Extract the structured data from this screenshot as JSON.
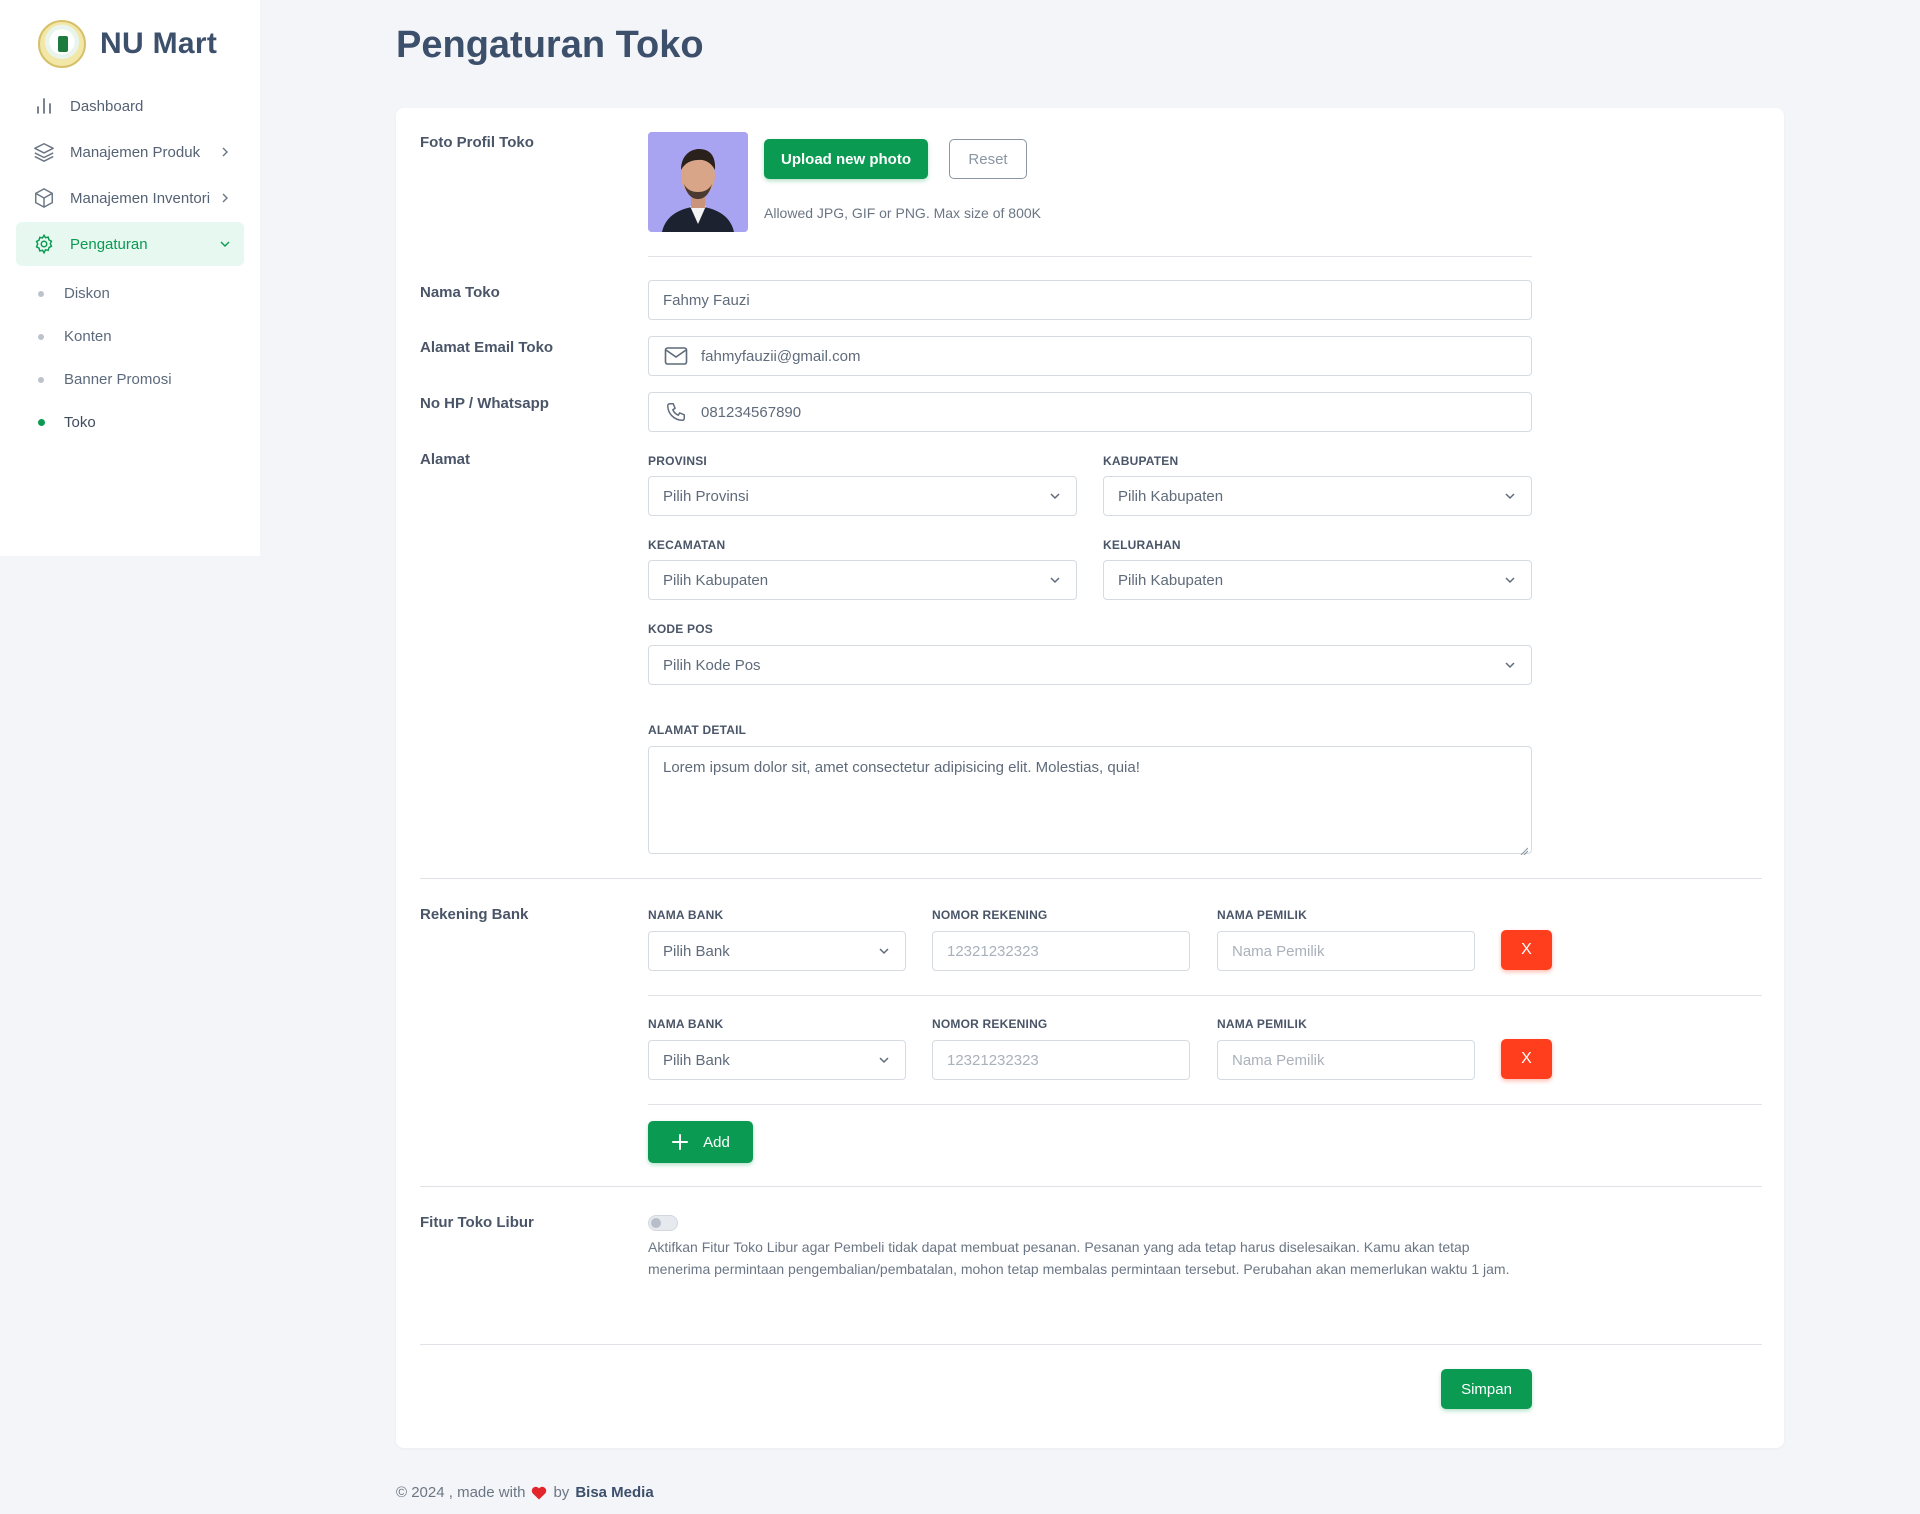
{
  "brand": {
    "name": "NU Mart"
  },
  "sidebar": {
    "items": [
      {
        "label": "Dashboard",
        "icon": "bar-chart-icon"
      },
      {
        "label": "Manajemen Produk",
        "icon": "layers-icon"
      },
      {
        "label": "Manajemen Inventori",
        "icon": "box-icon"
      },
      {
        "label": "Pengaturan",
        "icon": "gear-icon",
        "active": true
      }
    ],
    "subitems": [
      {
        "label": "Diskon"
      },
      {
        "label": "Konten"
      },
      {
        "label": "Banner Promosi"
      },
      {
        "label": "Toko",
        "active": true
      }
    ]
  },
  "page": {
    "title": "Pengaturan Toko"
  },
  "form": {
    "photo": {
      "label": "Foto Profil Toko",
      "upload_label": "Upload new photo",
      "reset_label": "Reset",
      "help": "Allowed JPG, GIF or PNG. Max size of 800K"
    },
    "nama_toko": {
      "label": "Nama Toko",
      "value": "Fahmy Fauzi"
    },
    "email": {
      "label": "Alamat Email Toko",
      "value": "fahmyfauzii@gmail.com"
    },
    "phone": {
      "label": "No HP / Whatsapp",
      "value": "081234567890"
    },
    "alamat": {
      "label": "Alamat",
      "provinsi": {
        "label": "PROVINSI",
        "value": "Pilih Provinsi"
      },
      "kabupaten": {
        "label": "KABUPATEN",
        "value": "Pilih Kabupaten"
      },
      "kecamatan": {
        "label": "KECAMATAN",
        "value": "Pilih Kabupaten"
      },
      "kelurahan": {
        "label": "KELURAHAN",
        "value": "Pilih Kabupaten"
      },
      "kode_pos": {
        "label": "KODE POS",
        "value": "Pilih Kode Pos"
      },
      "detail": {
        "label": "ALAMAT DETAIL",
        "value": "Lorem ipsum dolor sit, amet consectetur adipisicing elit. Molestias, quia!"
      }
    },
    "bank": {
      "label": "Rekening Bank",
      "rows": [
        {
          "bank_label": "NAMA BANK",
          "bank_value": "Pilih Bank",
          "rek_label": "NOMOR REKENING",
          "rek_placeholder": "12321232323",
          "owner_label": "NAMA PEMILIK",
          "owner_placeholder": "Nama Pemilik",
          "remove_label": "X"
        },
        {
          "bank_label": "NAMA BANK",
          "bank_value": "Pilih Bank",
          "rek_label": "NOMOR REKENING",
          "rek_placeholder": "12321232323",
          "owner_label": "NAMA PEMILIK",
          "owner_placeholder": "Nama Pemilik",
          "remove_label": "X"
        }
      ],
      "add_label": "Add"
    },
    "libur": {
      "label": "Fitur Toko Libur",
      "enabled": false,
      "help": "Aktifkan Fitur Toko Libur agar Pembeli tidak dapat membuat pesanan. Pesanan yang ada tetap harus diselesaikan. Kamu akan tetap menerima permintaan pengembalian/pembatalan, mohon tetap membalas permintaan tersebut. Perubahan akan memerlukan waktu 1 jam."
    },
    "save_label": "Simpan"
  },
  "footer": {
    "prefix": "© 2024 , made with",
    "by": "by",
    "company": "Bisa Media"
  },
  "colors": {
    "primary": "#0a9a52",
    "danger": "#ff3e1d",
    "heading": "#3c4f6b"
  }
}
